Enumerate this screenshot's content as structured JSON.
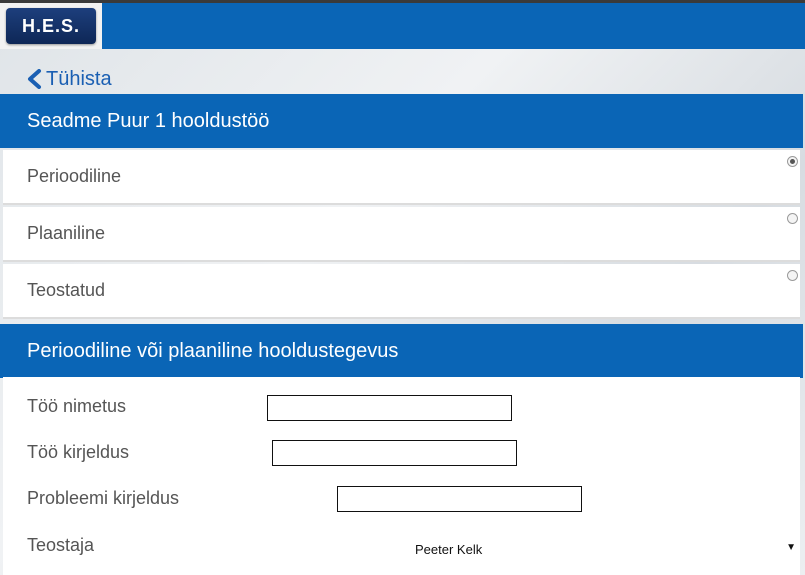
{
  "app": {
    "logo_text": "H.E.S."
  },
  "nav": {
    "back_label": "Tühista"
  },
  "status_section": {
    "title": "Seadme Puur 1 hooldustöö",
    "options": [
      {
        "label": "Perioodiline",
        "selected": true
      },
      {
        "label": "Plaaniline",
        "selected": false
      },
      {
        "label": "Teostatud",
        "selected": false
      }
    ]
  },
  "activity_section": {
    "title": "Perioodiline või plaaniline hooldustegevus",
    "fields": {
      "work_name": {
        "label": "Töö nimetus",
        "value": ""
      },
      "work_description": {
        "label": "Töö kirjeldus",
        "value": ""
      },
      "problem_description": {
        "label": "Probleemi kirjeldus",
        "value": ""
      },
      "performer": {
        "label": "Teostaja",
        "selected": "Peeter Kelk"
      }
    }
  },
  "colors": {
    "header": "#0a65b6",
    "link": "#1a5fb3"
  }
}
